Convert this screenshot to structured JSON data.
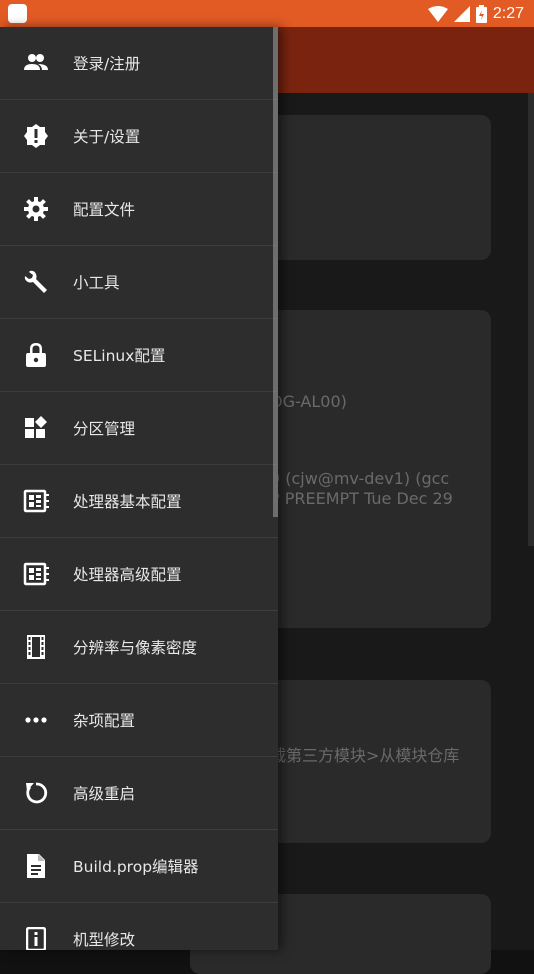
{
  "status_bar": {
    "time": "2:27",
    "color": "#e25a24"
  },
  "background": {
    "text_model": "OG-AL00)",
    "text_kernel_1": "9 (cjw@mv-dev1) (gcc",
    "text_kernel_2": "P PREEMPT Tue Dec 29",
    "text_module": "载第三方模块>从模块仓库"
  },
  "drawer": {
    "items": [
      {
        "label": "登录/注册",
        "icon": "people-icon"
      },
      {
        "label": "关于/设置",
        "icon": "alert-icon"
      },
      {
        "label": "配置文件",
        "icon": "gear-icon"
      },
      {
        "label": "小工具",
        "icon": "wrench-icon"
      },
      {
        "label": "SELinux配置",
        "icon": "lock-icon"
      },
      {
        "label": "分区管理",
        "icon": "widgets-icon"
      },
      {
        "label": "处理器基本配置",
        "icon": "chip-icon"
      },
      {
        "label": "处理器高级配置",
        "icon": "chip-icon"
      },
      {
        "label": "分辨率与像素密度",
        "icon": "film-icon"
      },
      {
        "label": "杂项配置",
        "icon": "more-icon"
      },
      {
        "label": "高级重启",
        "icon": "restart-icon"
      },
      {
        "label": "Build.prop编辑器",
        "icon": "file-icon"
      },
      {
        "label": "机型修改",
        "icon": "info-icon"
      }
    ]
  }
}
